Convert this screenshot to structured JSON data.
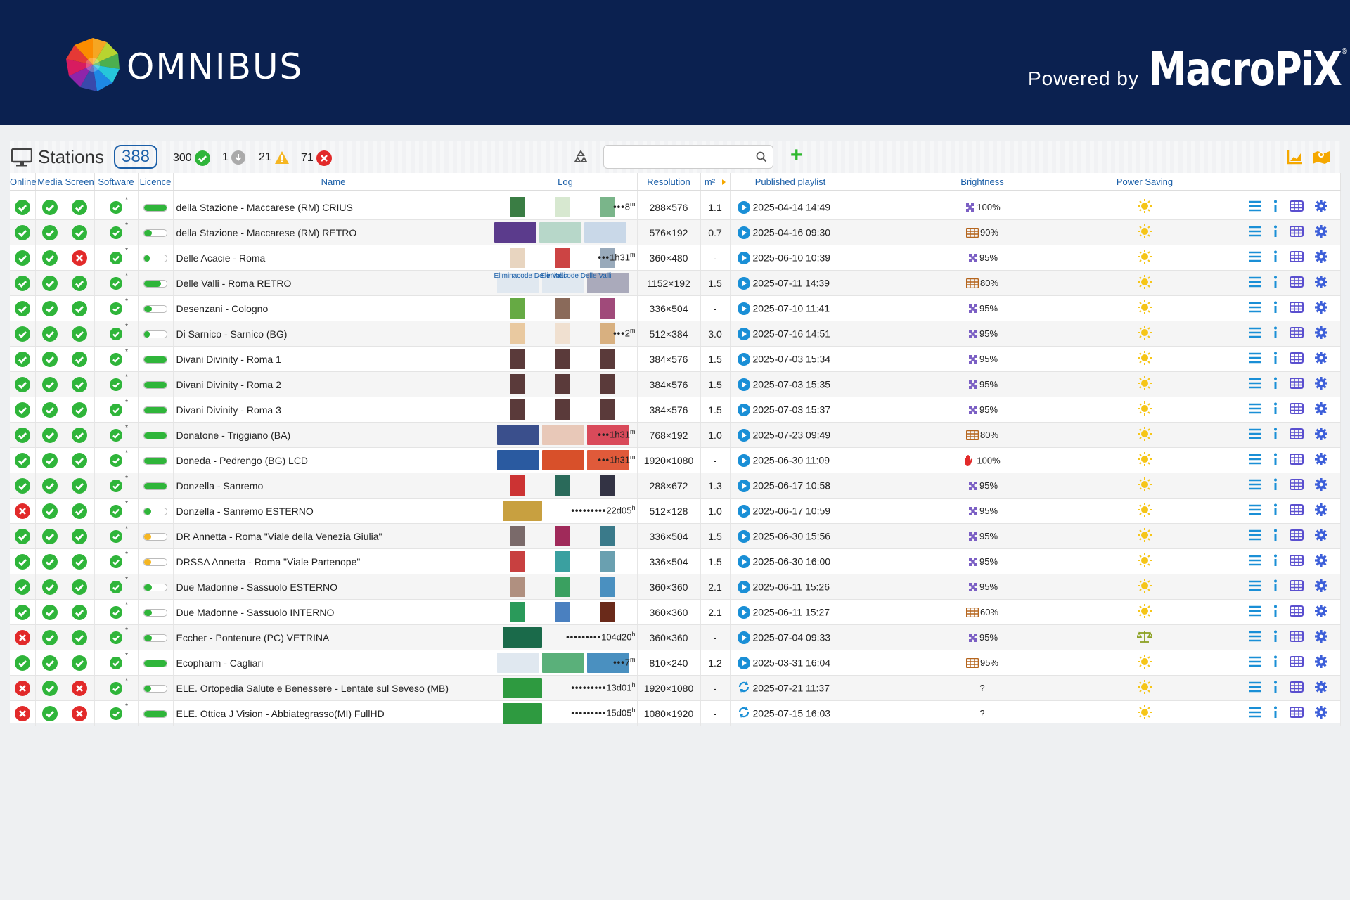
{
  "header": {
    "brand": "OMNIBUS",
    "powered_by": "Powered by",
    "partner": "MacroPiX",
    "partner_mark": "®"
  },
  "toolbar": {
    "title": "Stations",
    "total": "388",
    "online_count": "300",
    "unknown_count": "1",
    "warning_count": "21",
    "error_count": "71",
    "search_placeholder": "",
    "add_label": "+"
  },
  "columns": [
    "Online",
    "Media",
    "Screen",
    "Software",
    "Licence",
    "Name",
    "Log",
    "Resolution",
    "m²",
    "Published playlist",
    "Brightness",
    "Power Saving"
  ],
  "colors": {
    "ok": "#2fb53a",
    "error": "#e22a2a",
    "accent": "#1b5fa8",
    "header_bg": "#0b2150",
    "sun": "#f5c518"
  },
  "rows": [
    {
      "online": "ok",
      "media": "ok",
      "screen": "ok",
      "lic": 1.0,
      "lic_color": "ok",
      "name": "della Stazione - Maccarese (RM) CRIUS",
      "log": "8",
      "log_unit": "m",
      "log_prefix": "•••",
      "res": "288×576",
      "m2": "1.1",
      "pl_icon": "play",
      "date": "2025-04-14 14:49",
      "b_icon": "puzzle",
      "bright": "100%",
      "ps": "sun"
    },
    {
      "online": "ok",
      "media": "ok",
      "screen": "ok",
      "lic": 0.35,
      "lic_color": "ok",
      "name": "della Stazione - Maccarese (RM) RETRO",
      "log": "",
      "log_unit": "",
      "log_prefix": "",
      "res": "576×192",
      "m2": "0.7",
      "pl_icon": "play",
      "date": "2025-04-16 09:30",
      "b_icon": "grid",
      "bright": "90%",
      "ps": "sun"
    },
    {
      "online": "ok",
      "media": "ok",
      "screen": "err",
      "lic": 0.25,
      "lic_color": "ok",
      "name": "Delle Acacie - Roma",
      "log": "1h31",
      "log_unit": "m",
      "log_prefix": "•••",
      "res": "360×480",
      "m2": "-",
      "pl_icon": "play",
      "date": "2025-06-10 10:39",
      "b_icon": "puzzle",
      "bright": "95%",
      "ps": "sun"
    },
    {
      "online": "ok",
      "media": "ok",
      "screen": "ok",
      "lic": 0.75,
      "lic_color": "ok",
      "name": "Delle Valli - Roma RETRO",
      "log": "",
      "log_unit": "",
      "log_prefix": "",
      "res": "1152×192",
      "m2": "1.5",
      "pl_icon": "play",
      "date": "2025-07-11 14:39",
      "b_icon": "grid",
      "bright": "80%",
      "ps": "sun",
      "labels": [
        "Eliminacode Delle Valli",
        "Eliminacode Delle Valli"
      ]
    },
    {
      "online": "ok",
      "media": "ok",
      "screen": "ok",
      "lic": 0.35,
      "lic_color": "ok",
      "name": "Desenzani - Cologno",
      "log": "",
      "log_unit": "",
      "log_prefix": "",
      "res": "336×504",
      "m2": "-",
      "pl_icon": "play",
      "date": "2025-07-10 11:41",
      "b_icon": "puzzle",
      "bright": "95%",
      "ps": "sun"
    },
    {
      "online": "ok",
      "media": "ok",
      "screen": "ok",
      "lic": 0.25,
      "lic_color": "ok",
      "name": "Di Sarnico - Sarnico (BG)",
      "log": "2",
      "log_unit": "m",
      "log_prefix": "•••",
      "res": "512×384",
      "m2": "3.0",
      "pl_icon": "play",
      "date": "2025-07-16 14:51",
      "b_icon": "puzzle",
      "bright": "95%",
      "ps": "sun"
    },
    {
      "online": "ok",
      "media": "ok",
      "screen": "ok",
      "lic": 1.0,
      "lic_color": "ok",
      "name": "Divani Divinity - Roma 1",
      "log": "",
      "log_unit": "",
      "log_prefix": "",
      "res": "384×576",
      "m2": "1.5",
      "pl_icon": "play",
      "date": "2025-07-03 15:34",
      "b_icon": "puzzle",
      "bright": "95%",
      "ps": "sun"
    },
    {
      "online": "ok",
      "media": "ok",
      "screen": "ok",
      "lic": 1.0,
      "lic_color": "ok",
      "name": "Divani Divinity - Roma 2",
      "log": "",
      "log_unit": "",
      "log_prefix": "",
      "res": "384×576",
      "m2": "1.5",
      "pl_icon": "play",
      "date": "2025-07-03 15:35",
      "b_icon": "puzzle",
      "bright": "95%",
      "ps": "sun"
    },
    {
      "online": "ok",
      "media": "ok",
      "screen": "ok",
      "lic": 1.0,
      "lic_color": "ok",
      "name": "Divani Divinity - Roma 3",
      "log": "",
      "log_unit": "",
      "log_prefix": "",
      "res": "384×576",
      "m2": "1.5",
      "pl_icon": "play",
      "date": "2025-07-03 15:37",
      "b_icon": "puzzle",
      "bright": "95%",
      "ps": "sun"
    },
    {
      "online": "ok",
      "media": "ok",
      "screen": "ok",
      "lic": 1.0,
      "lic_color": "ok",
      "name": "Donatone - Triggiano (BA)",
      "log": "1h31",
      "log_unit": "m",
      "log_prefix": "•••",
      "res": "768×192",
      "m2": "1.0",
      "pl_icon": "play",
      "date": "2025-07-23 09:49",
      "b_icon": "grid",
      "bright": "80%",
      "ps": "sun"
    },
    {
      "online": "ok",
      "media": "ok",
      "screen": "ok",
      "lic": 1.0,
      "lic_color": "ok",
      "name": "Doneda - Pedrengo (BG) LCD",
      "log": "1h31",
      "log_unit": "m",
      "log_prefix": "•••",
      "res": "1920×1080",
      "m2": "-",
      "pl_icon": "play",
      "date": "2025-06-30 11:09",
      "b_icon": "hand",
      "bright": "100%",
      "ps": "sun"
    },
    {
      "online": "ok",
      "media": "ok",
      "screen": "ok",
      "lic": 1.0,
      "lic_color": "ok",
      "name": "Donzella - Sanremo",
      "log": "",
      "log_unit": "",
      "log_prefix": "",
      "res": "288×672",
      "m2": "1.3",
      "pl_icon": "play",
      "date": "2025-06-17 10:58",
      "b_icon": "puzzle",
      "bright": "95%",
      "ps": "sun"
    },
    {
      "online": "err",
      "media": "ok",
      "screen": "ok",
      "lic": 0.3,
      "lic_color": "ok",
      "name": "Donzella - Sanremo ESTERNO",
      "log": "22d05",
      "log_unit": "h",
      "log_prefix": "•••••••••",
      "res": "512×128",
      "m2": "1.0",
      "pl_icon": "play",
      "date": "2025-06-17 10:59",
      "b_icon": "puzzle",
      "bright": "95%",
      "ps": "sun"
    },
    {
      "online": "ok",
      "media": "ok",
      "screen": "ok",
      "lic": 0.3,
      "lic_color": "warn",
      "name": "DR Annetta - Roma \"Viale della Venezia Giulia\"",
      "log": "",
      "log_unit": "",
      "log_prefix": "",
      "res": "336×504",
      "m2": "1.5",
      "pl_icon": "play",
      "date": "2025-06-30 15:56",
      "b_icon": "puzzle",
      "bright": "95%",
      "ps": "sun"
    },
    {
      "online": "ok",
      "media": "ok",
      "screen": "ok",
      "lic": 0.3,
      "lic_color": "warn",
      "name": "DRSSA Annetta - Roma \"Viale Partenope\"",
      "log": "",
      "log_unit": "",
      "log_prefix": "",
      "res": "336×504",
      "m2": "1.5",
      "pl_icon": "play",
      "date": "2025-06-30 16:00",
      "b_icon": "puzzle",
      "bright": "95%",
      "ps": "sun"
    },
    {
      "online": "ok",
      "media": "ok",
      "screen": "ok",
      "lic": 0.35,
      "lic_color": "ok",
      "name": "Due Madonne - Sassuolo ESTERNO",
      "log": "",
      "log_unit": "",
      "log_prefix": "",
      "res": "360×360",
      "m2": "2.1",
      "pl_icon": "play",
      "date": "2025-06-11 15:26",
      "b_icon": "puzzle",
      "bright": "95%",
      "ps": "sun"
    },
    {
      "online": "ok",
      "media": "ok",
      "screen": "ok",
      "lic": 0.35,
      "lic_color": "ok",
      "name": "Due Madonne - Sassuolo INTERNO",
      "log": "",
      "log_unit": "",
      "log_prefix": "",
      "res": "360×360",
      "m2": "2.1",
      "pl_icon": "play",
      "date": "2025-06-11 15:27",
      "b_icon": "grid",
      "bright": "60%",
      "ps": "sun"
    },
    {
      "online": "err",
      "media": "ok",
      "screen": "ok",
      "lic": 0.35,
      "lic_color": "ok",
      "name": "Eccher - Pontenure (PC) VETRINA",
      "log": "104d20",
      "log_unit": "h",
      "log_prefix": "•••••••••",
      "res": "360×360",
      "m2": "-",
      "pl_icon": "play",
      "date": "2025-07-04 09:33",
      "b_icon": "puzzle",
      "bright": "95%",
      "ps": "scale"
    },
    {
      "online": "ok",
      "media": "ok",
      "screen": "ok",
      "lic": 1.0,
      "lic_color": "ok",
      "name": "Ecopharm - Cagliari",
      "log": "7",
      "log_unit": "m",
      "log_prefix": "•••",
      "res": "810×240",
      "m2": "1.2",
      "pl_icon": "play",
      "date": "2025-03-31 16:04",
      "b_icon": "grid",
      "bright": "95%",
      "ps": "sun"
    },
    {
      "online": "err",
      "media": "ok",
      "screen": "err",
      "lic": 0.3,
      "lic_color": "ok",
      "name": "ELE. Ortopedia Salute e Benessere - Lentate sul Seveso (MB)",
      "log": "13d01",
      "log_unit": "h",
      "log_prefix": "•••••••••",
      "res": "1920×1080",
      "m2": "-",
      "pl_icon": "sync",
      "date": "2025-07-21 11:37",
      "b_icon": "none",
      "bright": "?",
      "ps": "sun"
    },
    {
      "online": "err",
      "media": "ok",
      "screen": "err",
      "lic": 1.0,
      "lic_color": "ok",
      "name": "ELE. Ottica J Vision - Abbiategrasso(MI) FullHD",
      "log": "15d05",
      "log_unit": "h",
      "log_prefix": "•••••••••",
      "res": "1080×1920",
      "m2": "-",
      "pl_icon": "sync",
      "date": "2025-07-15 16:03",
      "b_icon": "none",
      "bright": "?",
      "ps": "sun"
    }
  ]
}
